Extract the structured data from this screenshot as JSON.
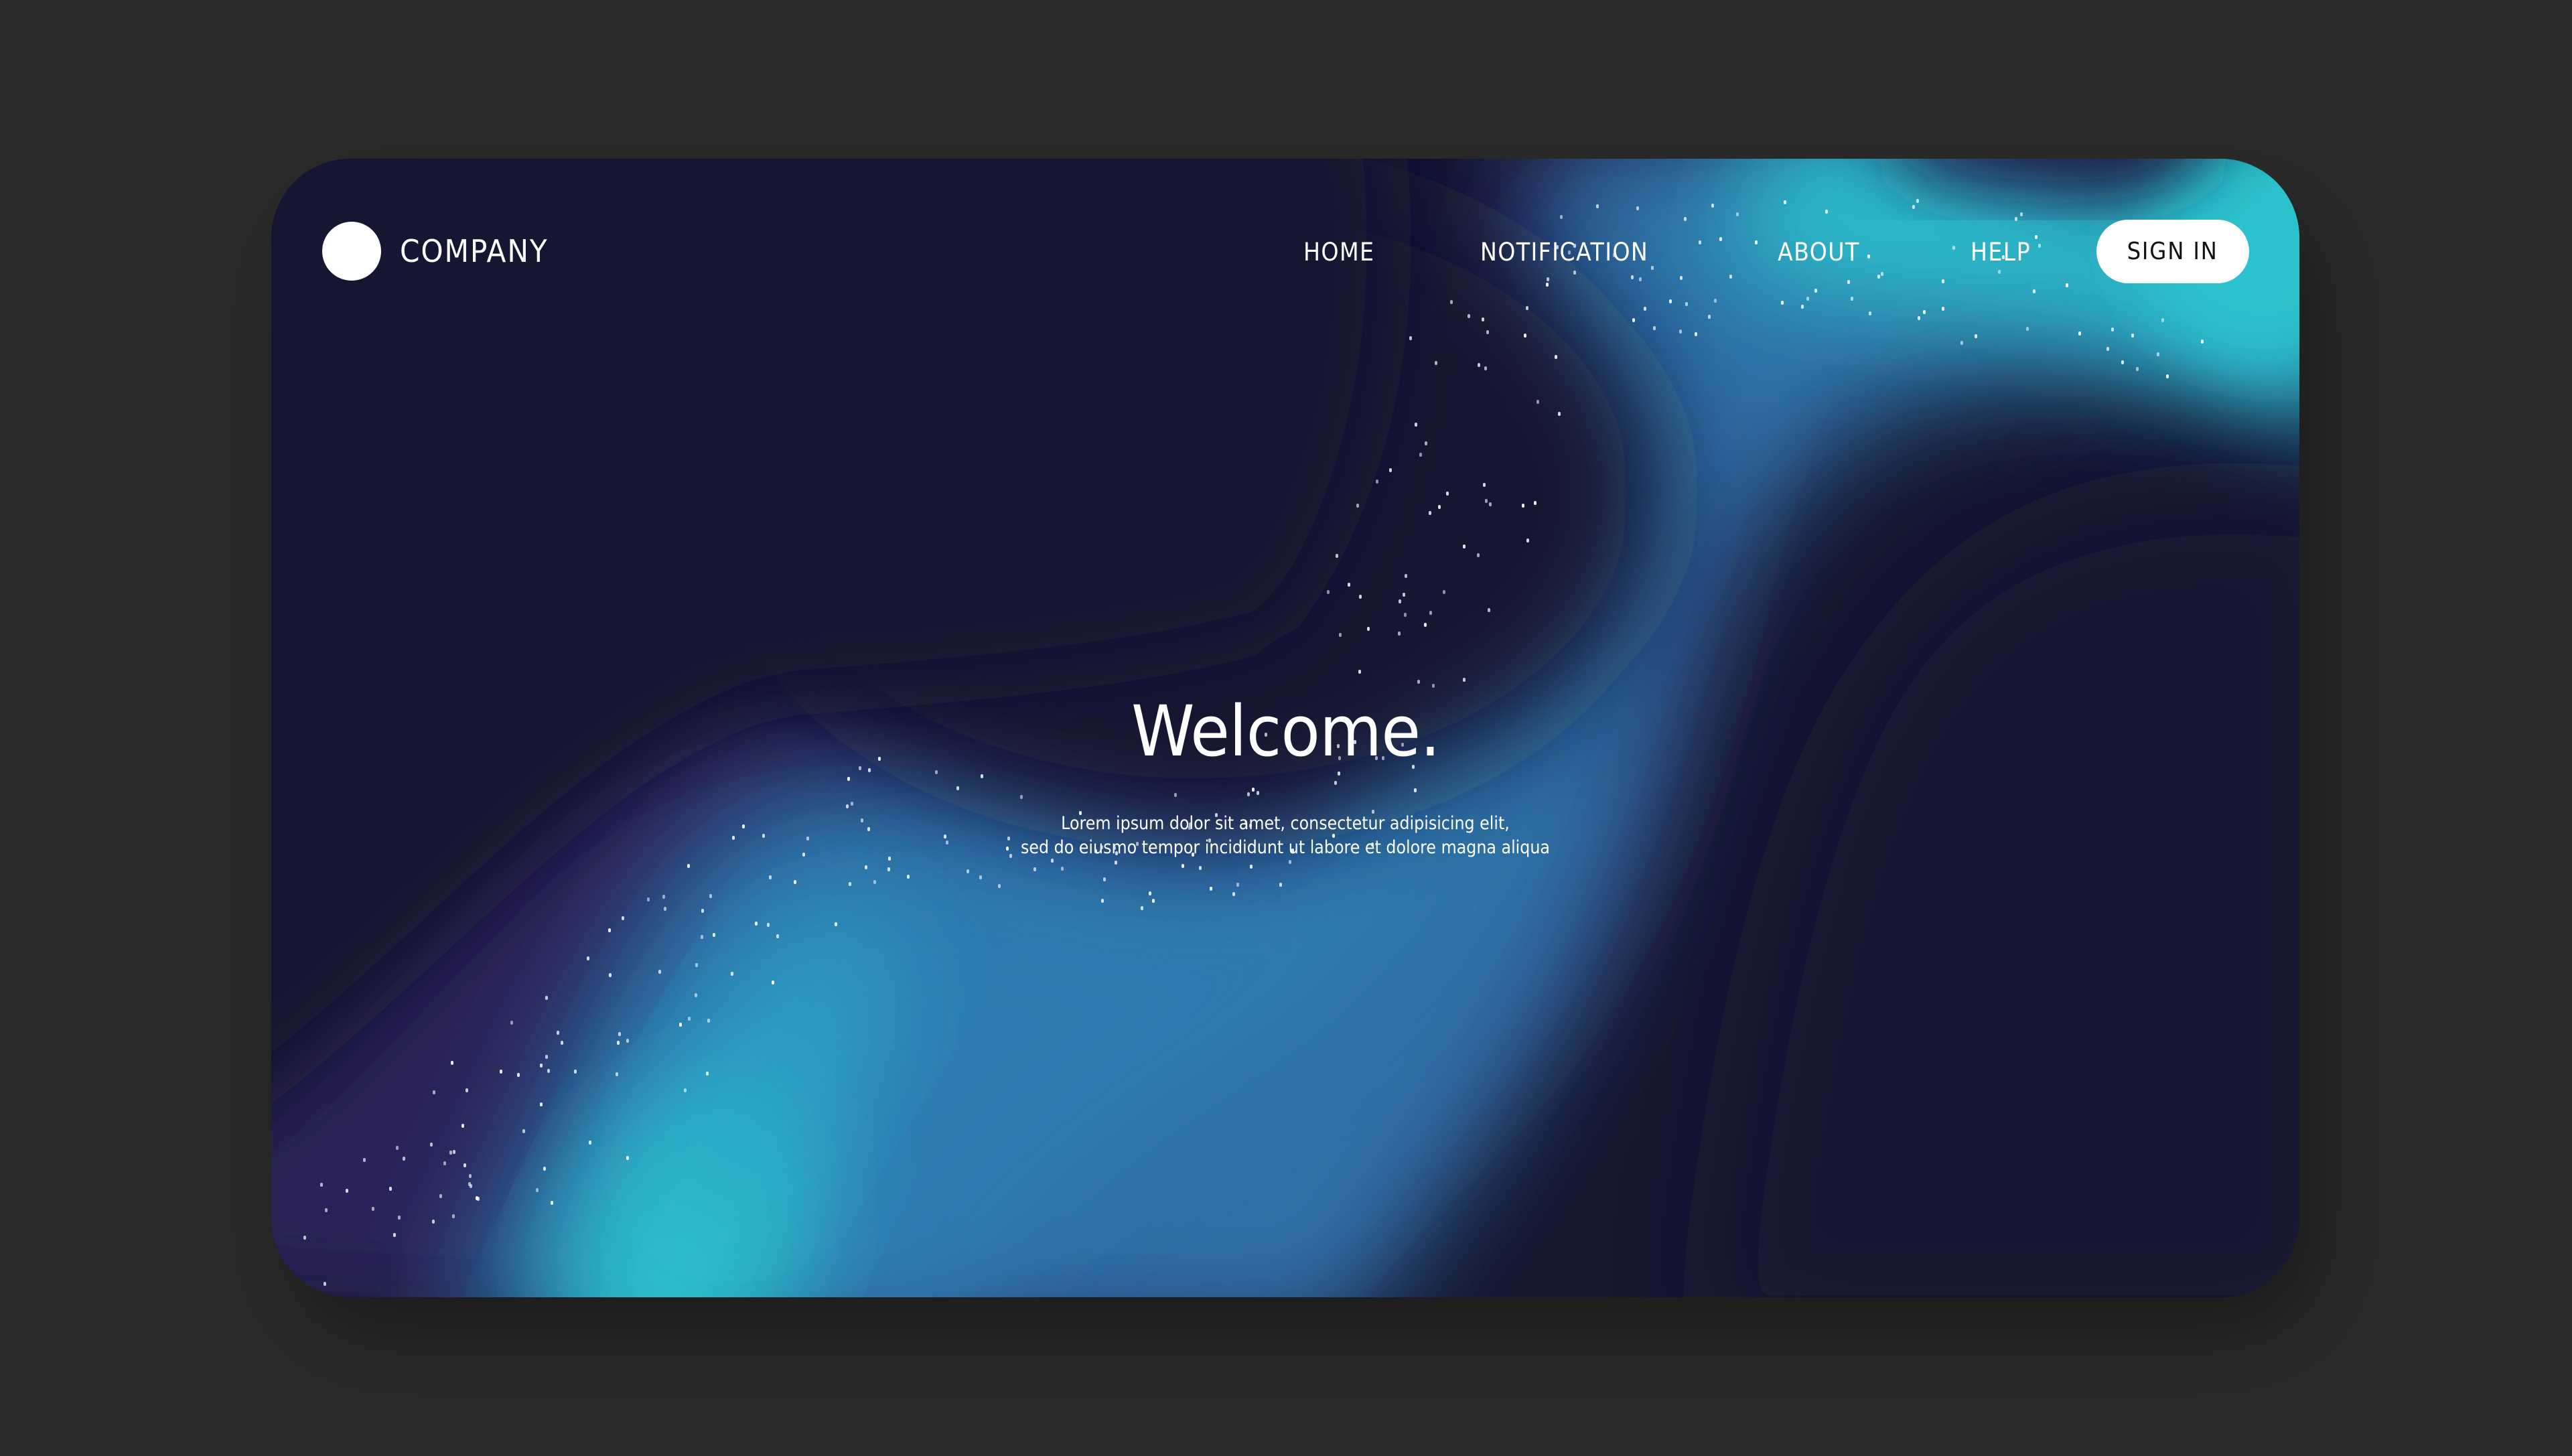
{
  "page": {
    "background_color": "#2b2b2b"
  },
  "card": {
    "base_color": "#161730",
    "aurora_colors": {
      "deep_navy": "#161730",
      "purple": "#2a2458",
      "blue": "#2e6fa5",
      "cyan": "#2bc0cc"
    }
  },
  "header": {
    "logo_text": "COMPANY",
    "nav": [
      {
        "label": "HOME"
      },
      {
        "label": "NOTIFICATION"
      },
      {
        "label": "ABOUT"
      },
      {
        "label": "HELP"
      }
    ],
    "signin_label": "SIGN IN"
  },
  "hero": {
    "title": "Welcome.",
    "text_lines": [
      "Lorem ipsum dolor sit amet, consectetur adipisicing elit,",
      "sed do eiusmo tempor incididunt ut labore et dolore magna aliqua"
    ]
  }
}
